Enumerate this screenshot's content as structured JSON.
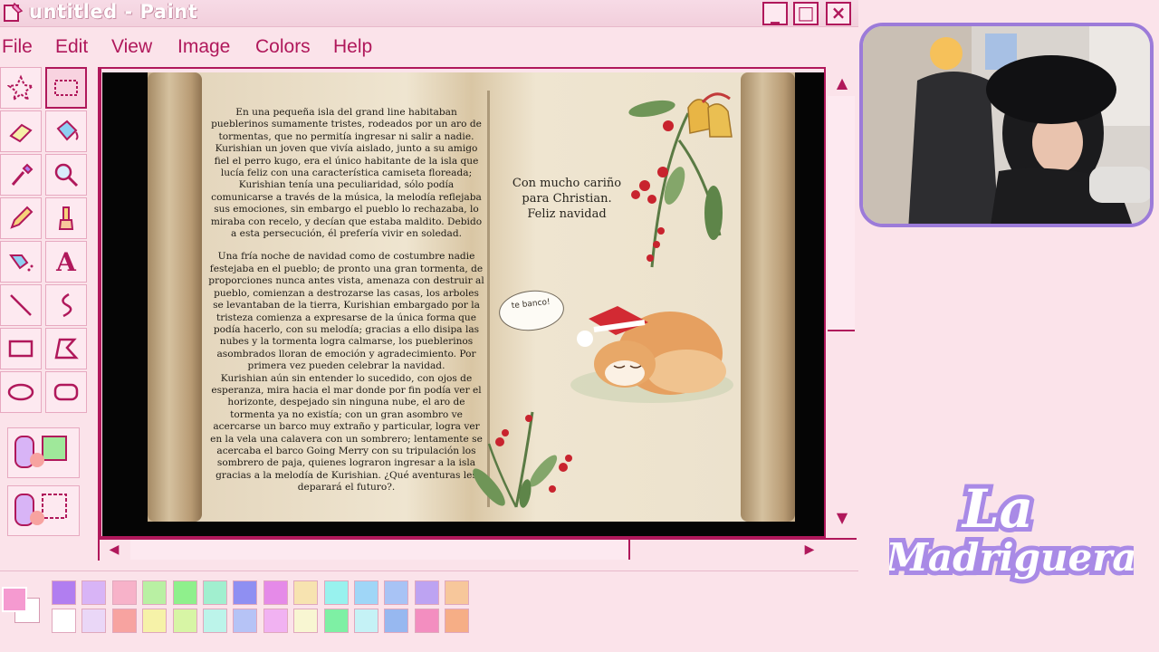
{
  "window": {
    "title": "untitled - Paint",
    "minimize": "_",
    "maximize": "□",
    "close": "×"
  },
  "menu": [
    "File",
    "Edit",
    "View",
    "Image",
    "Colors",
    "Help"
  ],
  "tools": [
    {
      "name": "free-select-icon"
    },
    {
      "name": "rect-select-icon"
    },
    {
      "name": "eraser-icon"
    },
    {
      "name": "fill-bucket-icon"
    },
    {
      "name": "color-picker-icon"
    },
    {
      "name": "magnifier-icon"
    },
    {
      "name": "pencil-icon"
    },
    {
      "name": "brush-icon"
    },
    {
      "name": "airbrush-icon"
    },
    {
      "name": "text-icon",
      "glyph": "A"
    },
    {
      "name": "line-icon"
    },
    {
      "name": "curve-icon"
    },
    {
      "name": "rectangle-icon"
    },
    {
      "name": "polygon-icon"
    },
    {
      "name": "ellipse-icon"
    },
    {
      "name": "rounded-rectangle-icon"
    }
  ],
  "book": {
    "story_paragraphs": [
      "En una pequeña isla del grand line habitaban pueblerinos sumamente tristes, rodeados por un aro de tormentas, que no permitía ingresar ni salir a nadie. Kurishian un joven que vivía aislado, junto a su amigo fiel el perro kugo, era el único habitante de la isla que lucía feliz con una característica camiseta floreada; Kurishian tenía una peculiaridad, sólo podía comunicarse a través de la música, la melodía reflejaba sus emociones, sin embargo el pueblo lo rechazaba, lo miraba con recelo, y decían que estaba maldito. Debido a esta persecución, él prefería vivir en soledad.",
      "Una fría noche de navidad como de costumbre nadie festejaba en el pueblo; de pronto una gran tormenta, de proporciones nunca antes vista, amenaza con destruir al pueblo, comienzan a destrozarse las casas, los arboles se levantaban de la tierra, Kurishian embargado por la tristeza comienza a expresarse de la única forma que podía hacerlo, con su melodía; gracias a ello disipa las nubes y la tormenta logra calmarse, los pueblerinos asombrados lloran de emoción y agradecimiento. Por primera vez pueden celebrar la navidad.",
      "Kurishian aún sin entender lo sucedido, con ojos de esperanza, mira hacia el mar donde por fin podía ver el horizonte, despejado sin ninguna nube, el aro de tormenta ya no existía; con un gran asombro ve acercarse un barco muy extraño y particular, logra ver en la vela una calavera con un sombrero; lentamente se acercaba el barco Going Merry con su tripulación los sombrero de paja, quienes lograron ingresar a la isla gracias a la melodía de Kurishian. ¿Qué aventuras les deparará el futuro?."
    ],
    "dedication_line1": "Con mucho cariño",
    "dedication_line2": "para Christian.",
    "dedication_line3": "Feliz navidad",
    "bubble_text": "te banco!"
  },
  "palette": {
    "foreground": "#f59ad0",
    "background": "#ffffff",
    "row1": [
      "#b17ef0",
      "#d8b4f6",
      "#f7b2c9",
      "#b9f0a3",
      "#8ff08c",
      "#a1efcf",
      "#8f8ff2",
      "#e58ae8",
      "#f7e3b0",
      "#98f2ee",
      "#9fd6f7",
      "#a8c3f5",
      "#bda3f2",
      "#f7c79b"
    ],
    "row2": [
      "#ffffff",
      "#ead7f7",
      "#f7a3a0",
      "#f6f2a8",
      "#d7f5a5",
      "#bcf4ea",
      "#b6c3f6",
      "#f1b2f2",
      "#f8f6d2",
      "#7ef0a4",
      "#c5f2f6",
      "#97b8f0",
      "#f38ec0",
      "#f6ae86"
    ]
  },
  "overlay": {
    "logo_line1": "La",
    "logo_line2": "Madriguera"
  }
}
